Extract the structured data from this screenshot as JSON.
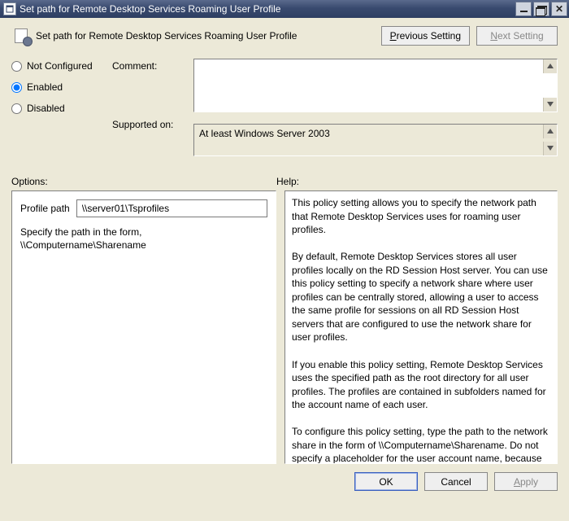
{
  "window": {
    "title": "Set path for Remote Desktop Services Roaming User Profile"
  },
  "header": {
    "title": "Set path for Remote Desktop Services Roaming User Profile",
    "previous_p": "P",
    "previous_rest": "revious Setting",
    "next_n": "N",
    "next_rest": "ext Setting"
  },
  "state": {
    "not_configured": "Not Configured",
    "enabled": "Enabled",
    "disabled": "Disabled",
    "selected": "enabled"
  },
  "labels": {
    "comment": "Comment:",
    "supported_on": "Supported on:",
    "options": "Options:",
    "help": "Help:"
  },
  "supported": {
    "text": "At least Windows Server 2003"
  },
  "comment": {
    "value": ""
  },
  "options": {
    "profile_path_label": "Profile path",
    "profile_path_value": "\\\\server01\\Tsprofiles",
    "instruction_l1": "Specify the path in the form,",
    "instruction_l2": "\\\\Computername\\Sharename"
  },
  "help": {
    "text": "This policy setting allows you to specify the network path that Remote Desktop Services uses for roaming user profiles.\n\nBy default, Remote Desktop Services stores all user profiles locally on the RD Session Host server. You can use this policy setting to specify a network share where user profiles can be centrally stored, allowing a user to access the same profile for sessions on all RD Session Host servers that are configured to use the network share for user profiles.\n\nIf you enable this policy setting, Remote Desktop Services uses the specified path as the root directory for all user profiles. The profiles are contained in subfolders named for the account name of each user.\n\nTo configure this policy setting, type the path to the network share in the form of \\\\Computername\\Sharename. Do not specify a placeholder for the user account name, because Remote Desktop Services automatically adds this when the user logs on and the profile is created. If the specified network share does not exist, Remote Desktop Services displays an error message on the"
  },
  "buttons": {
    "ok": "OK",
    "cancel": "Cancel",
    "apply_a": "A",
    "apply_rest": "pply"
  }
}
